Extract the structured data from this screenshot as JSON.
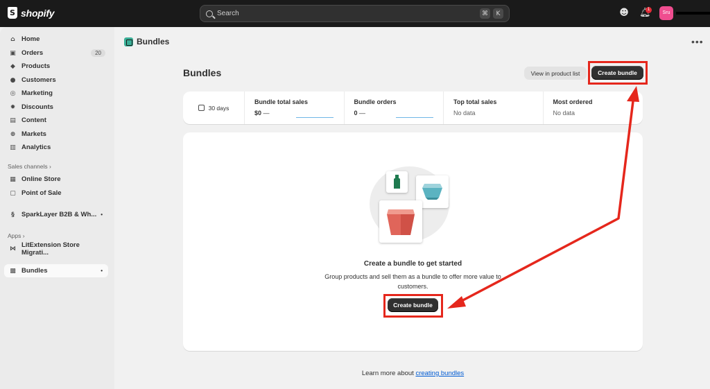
{
  "topbar": {
    "brand": "shopify",
    "search_placeholder": "Search",
    "shortcut_keys": [
      "⌘",
      "K"
    ],
    "notification_count": "1",
    "avatar_initials": "Sru"
  },
  "sidebar": {
    "main_items": [
      {
        "label": "Home",
        "icon": "home-icon"
      },
      {
        "label": "Orders",
        "icon": "inbox-icon",
        "count": "20"
      },
      {
        "label": "Products",
        "icon": "tag-icon"
      },
      {
        "label": "Customers",
        "icon": "person-icon"
      },
      {
        "label": "Marketing",
        "icon": "target-icon"
      },
      {
        "label": "Discounts",
        "icon": "discount-icon"
      },
      {
        "label": "Content",
        "icon": "content-icon"
      },
      {
        "label": "Markets",
        "icon": "globe-icon"
      },
      {
        "label": "Analytics",
        "icon": "chart-bar-icon"
      }
    ],
    "sales_channels_title": "Sales channels",
    "sales_channels": [
      {
        "label": "Online Store",
        "icon": "store-icon"
      },
      {
        "label": "Point of Sale",
        "icon": "pos-icon"
      }
    ],
    "sparklayer_label": "SparkLayer B2B & Wh...",
    "apps_title": "Apps",
    "apps": [
      {
        "label": "LitExtension Store Migrati...",
        "icon": "bowtie-icon"
      }
    ],
    "active_item": {
      "label": "Bundles",
      "icon": "bundles-icon"
    }
  },
  "page": {
    "crumb_title": "Bundles",
    "heading": "Bundles",
    "view_product_list_label": "View in product list",
    "create_bundle_label": "Create bundle"
  },
  "stats": {
    "date_range": "30 days",
    "items": [
      {
        "label": "Bundle total sales",
        "value": "$0",
        "dash": "—"
      },
      {
        "label": "Bundle orders",
        "value": "0",
        "dash": "—"
      },
      {
        "label": "Top total sales",
        "value": "No data"
      },
      {
        "label": "Most ordered",
        "value": "No data"
      }
    ]
  },
  "empty_state": {
    "title": "Create a bundle to get started",
    "description": "Group products and sell them as a bundle to offer more value to customers.",
    "button_label": "Create bundle"
  },
  "footer": {
    "learn_prefix": "Learn more about",
    "learn_link": "creating bundles"
  },
  "colors": {
    "highlight": "#e5271c",
    "primary_button": "#303030",
    "link": "#005bd3"
  }
}
